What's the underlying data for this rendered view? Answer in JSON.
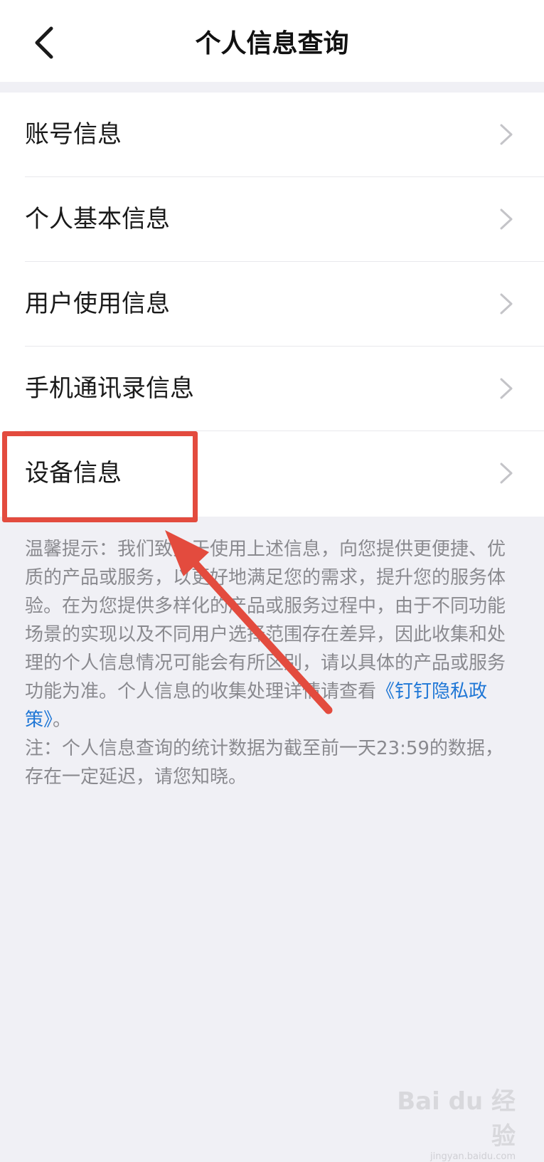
{
  "header": {
    "title": "个人信息查询",
    "back_icon": "chevron-left-icon"
  },
  "menu": {
    "items": [
      {
        "label": "账号信息"
      },
      {
        "label": "个人基本信息"
      },
      {
        "label": "用户使用信息"
      },
      {
        "label": "手机通讯录信息"
      },
      {
        "label": "设备信息"
      }
    ],
    "chevron_icon": "chevron-right-icon"
  },
  "notice": {
    "tip_before_link": "温馨提示：我们致力于使用上述信息，向您提供更便捷、优质的产品或服务，以更好地满足您的需求，提升您的服务体验。在为您提供多样化的产品或服务过程中，由于不同功能场景的实现以及不同用户选择范围存在差异，因此收集和处理的个人信息情况可能会有所区别，请以具体的产品或服务功能为准。个人信息的收集处理详情请查看",
    "policy_link": "《钉钉隐私政策》",
    "tip_after_link": "。",
    "note": "注：个人信息查询的统计数据为截至前一天23:59的数据，存在一定延迟，请您知晓。"
  },
  "annotation": {
    "box_color": "#e34b3e",
    "arrow_color": "#e34b3e"
  },
  "colors": {
    "background": "#f0f0f5",
    "link": "#1f77d6",
    "muted_text": "#8a8a8f"
  },
  "watermark": {
    "brand": "Bai du 经验",
    "url": "jingyan.baidu.com"
  }
}
